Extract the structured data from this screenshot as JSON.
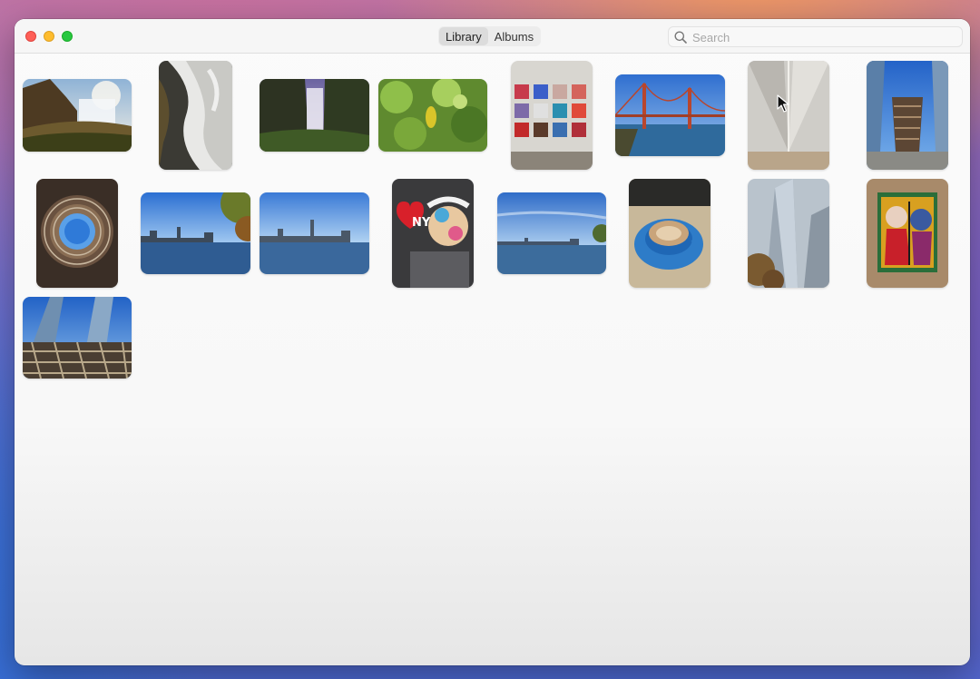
{
  "window": {
    "tabs": [
      {
        "label": "Library",
        "active": true
      },
      {
        "label": "Albums",
        "active": false
      }
    ],
    "search": {
      "placeholder": "Search",
      "value": ""
    }
  },
  "colors": {
    "close": "#fe5f57",
    "minimize": "#febc2e",
    "maximize": "#28c840"
  },
  "photos": [
    {
      "name": "waterfall-cliff-photo"
    },
    {
      "name": "rushing-water-photo"
    },
    {
      "name": "misty-waterfall-photo"
    },
    {
      "name": "green-leaves-photo"
    },
    {
      "name": "art-grid-wall-photo"
    },
    {
      "name": "golden-gate-bridge-photo"
    },
    {
      "name": "oculus-interior-photo"
    },
    {
      "name": "vessel-structure-photo"
    },
    {
      "name": "vessel-looking-up-photo"
    },
    {
      "name": "reservoir-skyline-photo-1"
    },
    {
      "name": "reservoir-skyline-photo-2"
    },
    {
      "name": "einstein-mural-photo"
    },
    {
      "name": "reservoir-skyline-photo-3"
    },
    {
      "name": "blue-coffee-cup-photo"
    },
    {
      "name": "world-trade-center-photo"
    },
    {
      "name": "picasso-painting-photo"
    },
    {
      "name": "vessel-towers-photo"
    }
  ]
}
